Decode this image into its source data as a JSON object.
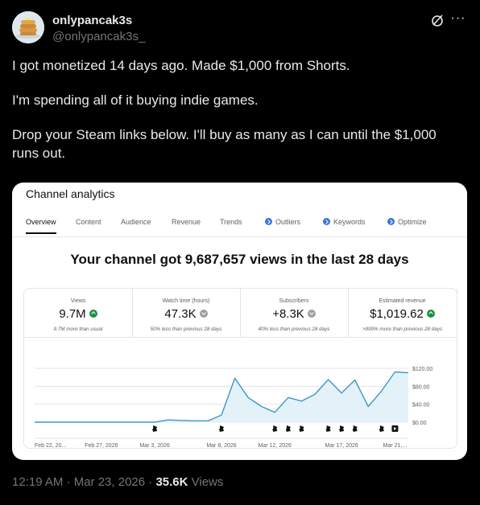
{
  "post": {
    "display_name": "onlypancak3s",
    "handle": "@onlypancak3s_",
    "paragraphs": [
      "I got monetized 14 days ago. Made $1,000 from Shorts.",
      "I'm spending all of it buying indie games.",
      "Drop your Steam links below. I'll buy as many as I can until the $1,000 runs out."
    ],
    "timestamp": "12:19 AM · Mar 23, 2026 · ",
    "views_count": "35.6K",
    "views_label": " Views"
  },
  "analytics": {
    "title": "Channel analytics",
    "tabs": [
      {
        "label": "Overview",
        "icon": false,
        "active": true
      },
      {
        "label": "Content",
        "icon": false,
        "active": false
      },
      {
        "label": "Audience",
        "icon": false,
        "active": false
      },
      {
        "label": "Revenue",
        "icon": false,
        "active": false
      },
      {
        "label": "Trends",
        "icon": false,
        "active": false
      },
      {
        "label": "Outliers",
        "icon": true,
        "active": false
      },
      {
        "label": "Keywords",
        "icon": true,
        "active": false
      },
      {
        "label": "Optimize",
        "icon": true,
        "active": false
      }
    ],
    "headline": "Your channel got 9,687,657 views in the last 28 days",
    "metrics": [
      {
        "label": "Views",
        "value": "9.7M",
        "trend": "up",
        "note": "9.7M more than usual"
      },
      {
        "label": "Watch time (hours)",
        "value": "47.3K",
        "trend": "down",
        "note": "50% less than previous 28 days"
      },
      {
        "label": "Subscribers",
        "value": "+8.3K",
        "trend": "down",
        "note": "40% less than previous 28 days"
      },
      {
        "label": "Estimated revenue",
        "value": "$1,019.62",
        "trend": "up",
        "note": ">999% more than previous 28 days"
      }
    ],
    "colors": {
      "line": "#3f98c4",
      "fill": "#e3f1f8",
      "grid": "#e5e5e5",
      "up": "#1e8e3e",
      "down": "#9e9e9e"
    }
  },
  "chart_data": {
    "type": "area",
    "title": "",
    "ylabel": "",
    "xlabel": "",
    "ylim": [
      0,
      120
    ],
    "yticks": [
      "$0.00",
      "$40.00",
      "$80.00",
      "$120.00"
    ],
    "ytick_values": [
      0,
      40,
      80,
      120
    ],
    "xtick_labels": [
      "Feb 22, 20...",
      "Feb 27, 2026",
      "Mar 3, 2026",
      "Mar 8, 2026",
      "Mar 12, 2026",
      "Mar 17, 2026",
      "Mar 21,..."
    ],
    "xtick_index": [
      0,
      5,
      9,
      14,
      18,
      23,
      27
    ],
    "series": [
      {
        "values": [
          0,
          0,
          0,
          0,
          0,
          0,
          0,
          0,
          0,
          0,
          5,
          4,
          3,
          3,
          16,
          98,
          55,
          35,
          22,
          55,
          47,
          62,
          95,
          65,
          94,
          35,
          70,
          112,
          110
        ]
      }
    ],
    "markers": [
      {
        "index": 9,
        "icon": "shorts-icon"
      },
      {
        "index": 14,
        "icon": "shorts-icon"
      },
      {
        "index": 18,
        "icon": "shorts-icon"
      },
      {
        "index": 19,
        "icon": "shorts-icon"
      },
      {
        "index": 20,
        "icon": "shorts-icon"
      },
      {
        "index": 22,
        "icon": "shorts-icon"
      },
      {
        "index": 23,
        "icon": "shorts-icon"
      },
      {
        "index": 24,
        "icon": "shorts-icon"
      },
      {
        "index": 26,
        "icon": "shorts-icon"
      },
      {
        "index": 27,
        "icon": "video-icon"
      }
    ]
  }
}
